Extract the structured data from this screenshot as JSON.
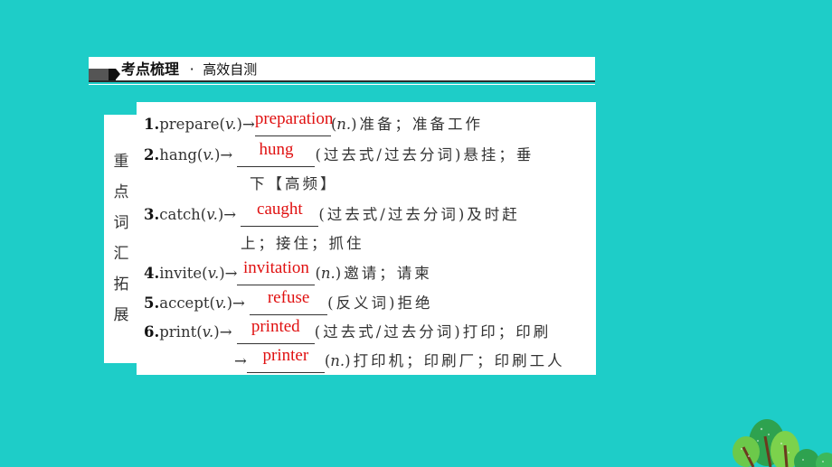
{
  "header": {
    "title_main": "考点梳理",
    "separator": "·",
    "title_sub": "高效自测"
  },
  "side_label": {
    "chars": [
      "重",
      "点",
      "词",
      "汇",
      "拓",
      "展"
    ]
  },
  "items": [
    {
      "num": "1.",
      "word": "prepare(",
      "pos": "v.",
      "after_pos": ")→",
      "answer": "preparation",
      "note_open": "(",
      "note_pos": "n.",
      "note_close": ")准备；准备工作"
    },
    {
      "num": "2.",
      "word": "hang(",
      "pos": "v.",
      "after_pos": ")→",
      "answer": "hung",
      "note": "(过去式/过去分词)悬挂；垂",
      "continuation": "下【高频】"
    },
    {
      "num": "3.",
      "word": "catch(",
      "pos": "v.",
      "after_pos": ")→",
      "answer": "caught",
      "note": "(过去式/过去分词)及时赶",
      "continuation": "上；接住；抓住"
    },
    {
      "num": "4.",
      "word": "invite(",
      "pos": "v.",
      "after_pos": ")→",
      "answer": "invitation",
      "note_open": "(",
      "note_pos": "n.",
      "note_close": ")邀请；请柬"
    },
    {
      "num": "5.",
      "word": "accept(",
      "pos": "v.",
      "after_pos": ")→",
      "answer": "refuse",
      "note": "(反义词)拒绝"
    },
    {
      "num": "6.",
      "word": "print(",
      "pos": "v.",
      "after_pos": ")→",
      "answer": "printed",
      "note": "(过去式/过去分词)打印；印刷",
      "second_arrow": "→",
      "second_answer": "printer",
      "second_note_open": "(",
      "second_note_pos": "n.",
      "second_note_close": ")打印机；印刷厂；印刷工人"
    }
  ],
  "colors": {
    "background": "#1ecdc8",
    "answer": "#e01010",
    "text": "#333333"
  }
}
